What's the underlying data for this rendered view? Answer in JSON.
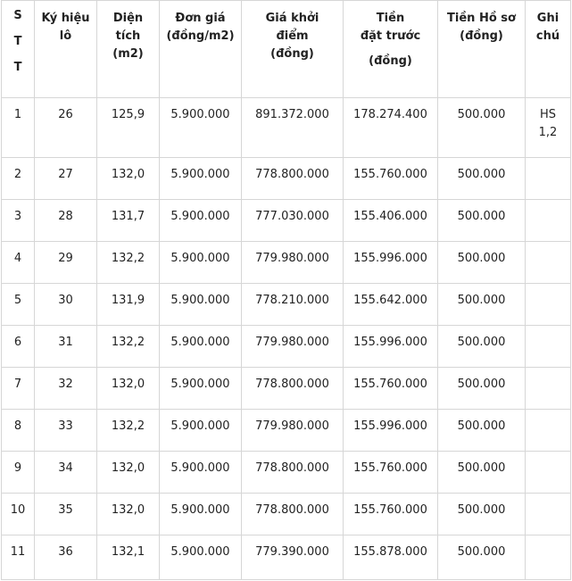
{
  "table": {
    "headers": {
      "stt": [
        "S",
        "T",
        "T"
      ],
      "ky_hieu_lo": [
        "Ký hiệu",
        "lô"
      ],
      "dien_tich": [
        "Diện",
        "tích",
        "(m2)"
      ],
      "don_gia": [
        "Đơn giá",
        "(đồng/m2)"
      ],
      "gia_khoi_diem": [
        "Giá khởi",
        "điểm",
        "(đồng)"
      ],
      "tien_dat_truoc": [
        "Tiền",
        "đặt trước",
        "(đồng)"
      ],
      "tien_ho_so": [
        "Tiền Hồ sơ",
        "(đồng)"
      ],
      "ghi_chu": [
        "Ghi",
        "chú"
      ]
    },
    "rows": [
      {
        "stt": "1",
        "lo": "26",
        "dien_tich": "125,9",
        "don_gia": "5.900.000",
        "gia_khoi_diem": "891.372.000",
        "tien_dat_truoc": "178.274.400",
        "tien_ho_so": "500.000",
        "ghi_chu": [
          "HS",
          "1,2"
        ]
      },
      {
        "stt": "2",
        "lo": "27",
        "dien_tich": "132,0",
        "don_gia": "5.900.000",
        "gia_khoi_diem": "778.800.000",
        "tien_dat_truoc": "155.760.000",
        "tien_ho_so": "500.000",
        "ghi_chu": [
          "",
          ""
        ]
      },
      {
        "stt": "3",
        "lo": "28",
        "dien_tich": "131,7",
        "don_gia": "5.900.000",
        "gia_khoi_diem": "777.030.000",
        "tien_dat_truoc": "155.406.000",
        "tien_ho_so": "500.000",
        "ghi_chu": [
          "",
          ""
        ]
      },
      {
        "stt": "4",
        "lo": "29",
        "dien_tich": "132,2",
        "don_gia": "5.900.000",
        "gia_khoi_diem": "779.980.000",
        "tien_dat_truoc": "155.996.000",
        "tien_ho_so": "500.000",
        "ghi_chu": [
          "",
          ""
        ]
      },
      {
        "stt": "5",
        "lo": "30",
        "dien_tich": "131,9",
        "don_gia": "5.900.000",
        "gia_khoi_diem": "778.210.000",
        "tien_dat_truoc": "155.642.000",
        "tien_ho_so": "500.000",
        "ghi_chu": [
          "",
          ""
        ]
      },
      {
        "stt": "6",
        "lo": "31",
        "dien_tich": "132,2",
        "don_gia": "5.900.000",
        "gia_khoi_diem": "779.980.000",
        "tien_dat_truoc": "155.996.000",
        "tien_ho_so": "500.000",
        "ghi_chu": [
          "",
          ""
        ]
      },
      {
        "stt": "7",
        "lo": "32",
        "dien_tich": "132,0",
        "don_gia": "5.900.000",
        "gia_khoi_diem": "778.800.000",
        "tien_dat_truoc": "155.760.000",
        "tien_ho_so": "500.000",
        "ghi_chu": [
          "",
          ""
        ]
      },
      {
        "stt": "8",
        "lo": "33",
        "dien_tich": "132,2",
        "don_gia": "5.900.000",
        "gia_khoi_diem": "779.980.000",
        "tien_dat_truoc": "155.996.000",
        "tien_ho_so": "500.000",
        "ghi_chu": [
          "",
          ""
        ]
      },
      {
        "stt": "9",
        "lo": "34",
        "dien_tich": "132,0",
        "don_gia": "5.900.000",
        "gia_khoi_diem": "778.800.000",
        "tien_dat_truoc": "155.760.000",
        "tien_ho_so": "500.000",
        "ghi_chu": [
          "",
          ""
        ]
      },
      {
        "stt": "10",
        "lo": "35",
        "dien_tich": "132,0",
        "don_gia": "5.900.000",
        "gia_khoi_diem": "778.800.000",
        "tien_dat_truoc": "155.760.000",
        "tien_ho_so": "500.000",
        "ghi_chu": [
          "",
          ""
        ]
      },
      {
        "stt": "11",
        "lo": "36",
        "dien_tich": "132,1",
        "don_gia": "5.900.000",
        "gia_khoi_diem": "779.390.000",
        "tien_dat_truoc": "155.878.000",
        "tien_ho_so": "500.000",
        "ghi_chu": [
          "",
          ""
        ]
      }
    ]
  }
}
